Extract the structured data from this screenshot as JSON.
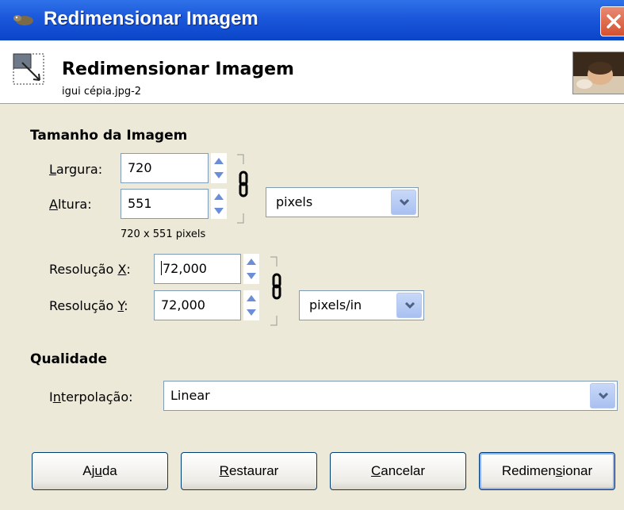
{
  "window": {
    "title": "Redimensionar Imagem"
  },
  "header": {
    "title": "Redimensionar Imagem",
    "subtitle": "igui cépia.jpg-2"
  },
  "image_size": {
    "section": "Tamanho da Imagem",
    "width_label": {
      "mnemonic": "L",
      "rest": "argura:"
    },
    "width_value": "720",
    "height_label": {
      "mnemonic": "A",
      "rest": "ltura:"
    },
    "height_value": "551",
    "size_note": "720 x 551 pixels",
    "unit": "pixels"
  },
  "resolution": {
    "x_label": {
      "prefix": "Resolução ",
      "mnemonic": "X",
      "suffix": ":"
    },
    "x_value": "72,000",
    "y_label": {
      "prefix": "Resolução ",
      "mnemonic": "Y",
      "suffix": ":"
    },
    "y_value": "72,000",
    "unit": "pixels/in"
  },
  "quality": {
    "section": "Qualidade",
    "interp_label": {
      "prefix": "I",
      "mnemonic": "n",
      "suffix": "terpolação:"
    },
    "interp_value": "Linear"
  },
  "buttons": {
    "help": {
      "prefix": "Aj",
      "mnemonic": "u",
      "suffix": "da"
    },
    "reset": {
      "prefix": "",
      "mnemonic": "R",
      "suffix": "estaurar"
    },
    "cancel": {
      "prefix": "",
      "mnemonic": "C",
      "suffix": "ancelar"
    },
    "resize": {
      "prefix": "Redimen",
      "mnemonic": "s",
      "suffix": "ionar"
    }
  },
  "colors": {
    "titlebar": "#0a45c8",
    "dialog_bg": "#ece9d8",
    "close_button": "#d4512f"
  }
}
